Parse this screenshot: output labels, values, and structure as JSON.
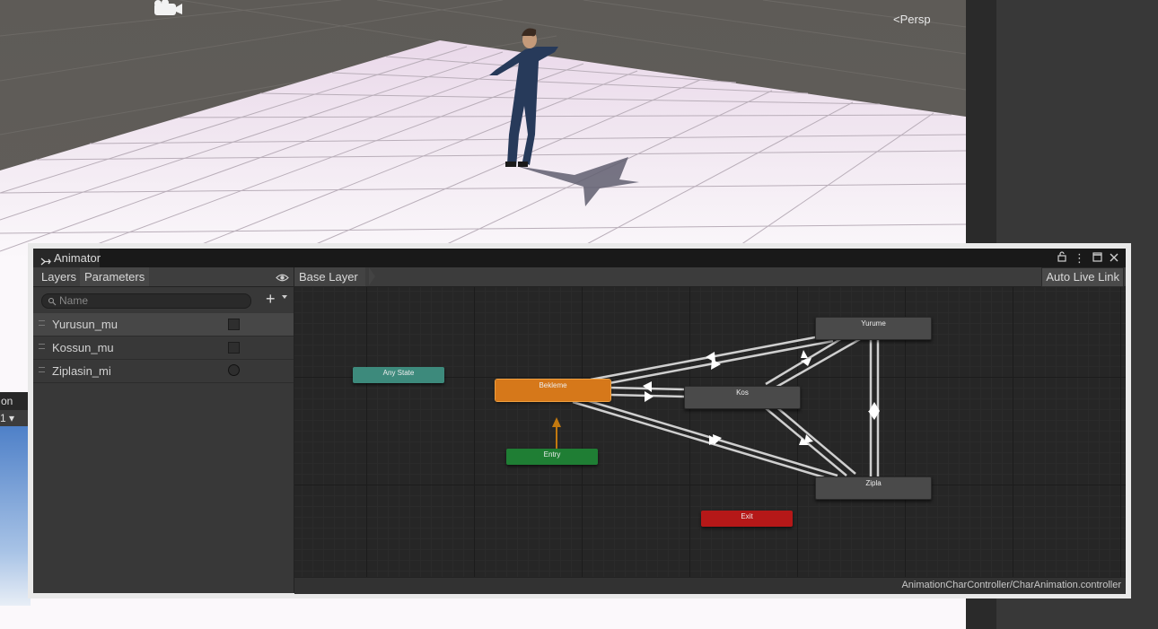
{
  "scene": {
    "view_mode_label": "Persp"
  },
  "left_fragment": {
    "label_top": "on",
    "label_second": "1"
  },
  "animator": {
    "window_title": "Animator",
    "tabs": [
      {
        "label": "Layers",
        "active": false
      },
      {
        "label": "Parameters",
        "active": true
      }
    ],
    "search_placeholder": "Name",
    "parameters": [
      {
        "name": "Yurusun_mu",
        "type": "bool",
        "value": false
      },
      {
        "name": "Kossun_mu",
        "type": "bool",
        "value": false
      },
      {
        "name": "Ziplasin_mi",
        "type": "trigger",
        "value": false
      }
    ],
    "breadcrumb": "Base Layer",
    "auto_live_link_label": "Auto Live Link",
    "status_path": "AnimationCharController/CharAnimation.controller",
    "states": {
      "any_state": "Any State",
      "bekleme": "Bekleme",
      "entry": "Entry",
      "kos": "Kos",
      "yurume": "Yurume",
      "zipla": "Zipla",
      "exit": "Exit"
    },
    "colors": {
      "any_state": "#3d8a7c",
      "default_state": "#d6781a",
      "entry": "#1f7e34",
      "state": "#4a4a4a",
      "exit": "#b51818",
      "transition": "#cfcfcf",
      "entry_transition": "#c2790f"
    }
  }
}
